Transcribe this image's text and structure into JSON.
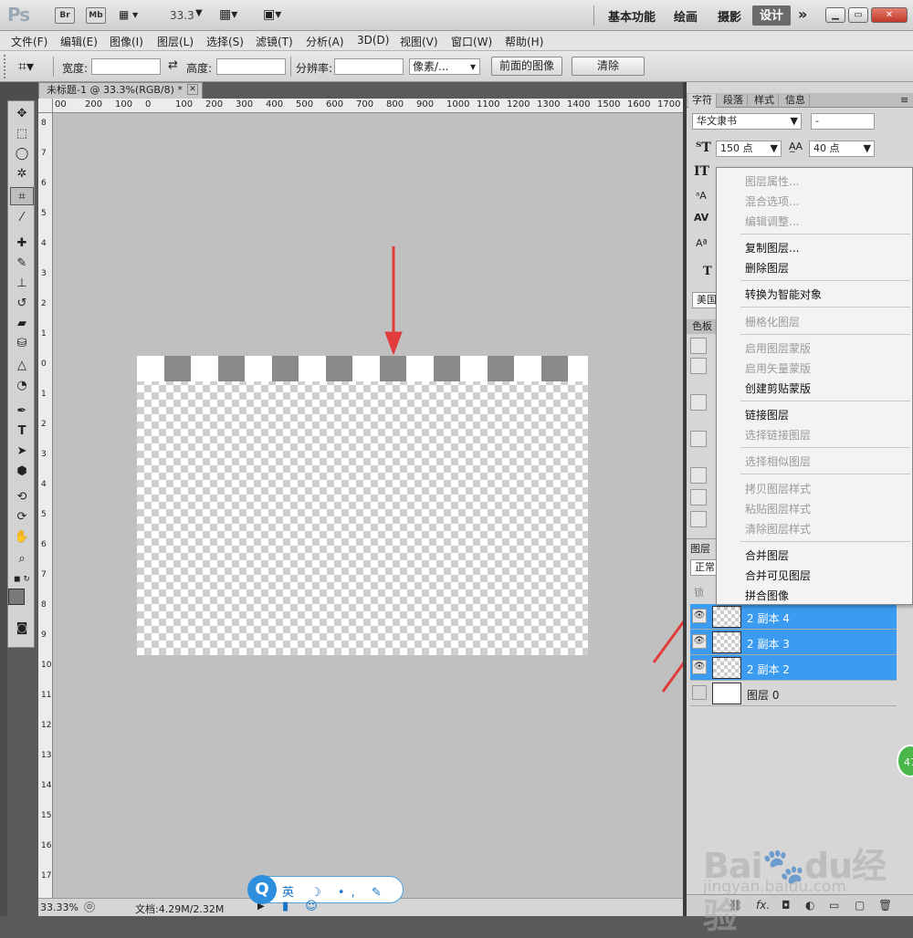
{
  "app": {
    "logo": "Ps",
    "bridge_buttons": [
      "Br",
      "Mb"
    ],
    "zoom_display": "33.3",
    "workspaces": [
      "基本功能",
      "绘画",
      "摄影",
      "设计"
    ],
    "active_workspace": "设计",
    "more": "»"
  },
  "menubar": [
    "文件(F)",
    "编辑(E)",
    "图像(I)",
    "图层(L)",
    "选择(S)",
    "滤镜(T)",
    "分析(A)",
    "3D(D)",
    "视图(V)",
    "窗口(W)",
    "帮助(H)"
  ],
  "options": {
    "width_label": "宽度:",
    "height_label": "高度:",
    "resolution_label": "分辨率:",
    "unit_value": "像素/...",
    "front_image_btn": "前面的图像",
    "clear_btn": "清除"
  },
  "document": {
    "tab_title": "未标题-1 @ 33.3%(RGB/8) *",
    "ruler_top": [
      "00",
      "200",
      "100",
      "0",
      "100",
      "200",
      "300",
      "400",
      "500",
      "600",
      "700",
      "800",
      "900",
      "1000",
      "1100",
      "1200",
      "1300",
      "1400",
      "1500",
      "1600",
      "1700"
    ],
    "ruler_left": [
      "8",
      "7",
      "6",
      "5",
      "4",
      "3",
      "2",
      "1",
      "0",
      "1",
      "2",
      "3",
      "4",
      "5",
      "6",
      "7",
      "8",
      "9",
      "10",
      "11",
      "12",
      "13",
      "14",
      "15",
      "16",
      "17"
    ],
    "stripe_blocks": 8
  },
  "status": {
    "zoom": "33.33%",
    "doc_info": "文档:4.29M/2.32M"
  },
  "ime": {
    "logo": "Q",
    "items": "英 ☽ •, ✎ ▮ ☺"
  },
  "character_panel": {
    "tabs": [
      "字符",
      "段落",
      "样式",
      "信息"
    ],
    "active_tab": "字符",
    "font_family": "华文隶书",
    "font_style": "-",
    "font_size": "150 点",
    "leading": "40 点",
    "language": "美国",
    "swatch_tab": "色板"
  },
  "layers_panel": {
    "tab": "图层",
    "blend_mode": "正常",
    "lock_label": "锁",
    "layers": [
      {
        "name": "2 副本 4",
        "selected": true,
        "visible": true
      },
      {
        "name": "2 副本 3",
        "selected": true,
        "visible": true
      },
      {
        "name": "2 副本 2",
        "selected": true,
        "visible": true
      },
      {
        "name": "图层 0",
        "selected": false,
        "visible": false
      }
    ],
    "footer_icons": [
      "link-icon",
      "fx-icon",
      "mask-icon",
      "adjustment-icon",
      "group-icon",
      "new-layer-icon",
      "trash-icon"
    ]
  },
  "context_menu": {
    "groups": [
      [
        {
          "label": "图层属性...",
          "enabled": false
        },
        {
          "label": "混合选项...",
          "enabled": false
        },
        {
          "label": "编辑调整...",
          "enabled": false
        }
      ],
      [
        {
          "label": "复制图层...",
          "enabled": true
        },
        {
          "label": "删除图层",
          "enabled": true
        }
      ],
      [
        {
          "label": "转换为智能对象",
          "enabled": true
        }
      ],
      [
        {
          "label": "栅格化图层",
          "enabled": false
        }
      ],
      [
        {
          "label": "启用图层蒙版",
          "enabled": false
        },
        {
          "label": "启用矢量蒙版",
          "enabled": false
        },
        {
          "label": "创建剪贴蒙版",
          "enabled": true
        }
      ],
      [
        {
          "label": "链接图层",
          "enabled": true
        },
        {
          "label": "选择链接图层",
          "enabled": false
        }
      ],
      [
        {
          "label": "选择相似图层",
          "enabled": false
        }
      ],
      [
        {
          "label": "拷贝图层样式",
          "enabled": false
        },
        {
          "label": "粘贴图层样式",
          "enabled": false
        },
        {
          "label": "清除图层样式",
          "enabled": false
        }
      ],
      [
        {
          "label": "合并图层",
          "enabled": true
        },
        {
          "label": "合并可见图层",
          "enabled": true
        },
        {
          "label": "拼合图像",
          "enabled": true
        }
      ]
    ]
  },
  "watermark": {
    "brand": "Bai",
    "brand2": "du",
    "brand3": "经验",
    "url": "jingyan.baidu.com"
  },
  "badge": "47",
  "colors": {
    "selection": "#3b9bf0",
    "arrow": "#e23b3b",
    "canvas_bg": "#c0c0c0"
  }
}
